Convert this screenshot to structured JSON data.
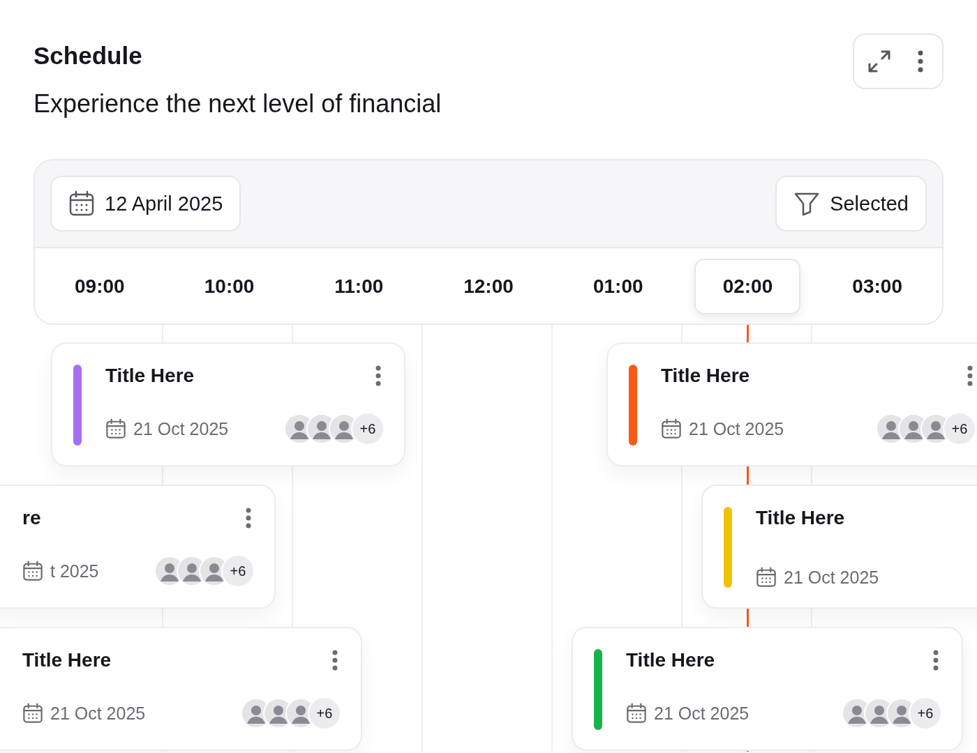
{
  "header": {
    "title": "Schedule",
    "subtitle": "Experience the next level of financial"
  },
  "toolbar": {
    "date": "12 April 2025",
    "filter": "Selected"
  },
  "hours": [
    {
      "label": "09:00",
      "selected": false
    },
    {
      "label": "10:00",
      "selected": false
    },
    {
      "label": "11:00",
      "selected": false
    },
    {
      "label": "12:00",
      "selected": false
    },
    {
      "label": "01:00",
      "selected": false
    },
    {
      "label": "02:00",
      "selected": true
    },
    {
      "label": "03:00",
      "selected": false
    }
  ],
  "cards": [
    {
      "title": "Title Here",
      "date": "21 Oct 2025",
      "color": "#a66ff0",
      "more": "+6"
    },
    {
      "title": "re",
      "date": "t 2025",
      "more": "+6"
    },
    {
      "title": "Title Here",
      "date": "21 Oct 2025",
      "more": "+6"
    },
    {
      "title": "Title Here",
      "date": "21 Oct 2025",
      "color": "#f85a14",
      "more": "+6"
    },
    {
      "title": "Title Here",
      "date": "21 Oct 2025",
      "color": "#f2c200"
    },
    {
      "title": "Title Here",
      "date": "21 Oct 2025",
      "color": "#16b34a",
      "more": "+6"
    }
  ]
}
